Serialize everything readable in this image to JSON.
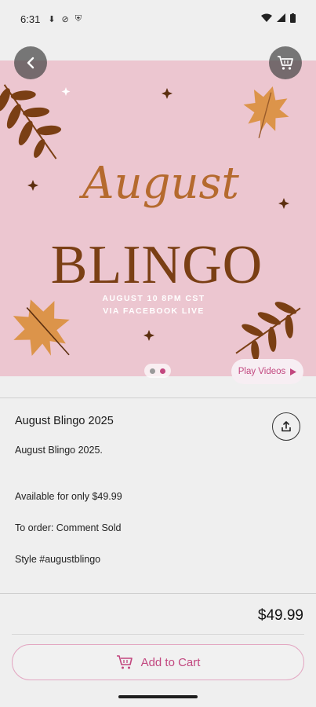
{
  "status_bar": {
    "time": "6:31"
  },
  "hero": {
    "script_title": "August",
    "main_title": "BLINGO",
    "line1": "AUGUST 10 8PM CST",
    "line2": "VIA FACEBOOK LIVE",
    "background_color": "#ecc6d0",
    "carousel": {
      "count": 2,
      "active_index": 1
    },
    "play_videos_label": "Play Videos"
  },
  "product": {
    "title": "August Blingo 2025",
    "description_lines": [
      "August Blingo 2025.",
      "Available for only $49.99",
      "To order: Comment Sold",
      "Style #augustblingo"
    ],
    "price": "$49.99",
    "add_to_cart_label": "Add to Cart"
  },
  "colors": {
    "accent": "#c2477f",
    "leaf_dark": "#7a3f14",
    "leaf_light": "#dc944a"
  }
}
